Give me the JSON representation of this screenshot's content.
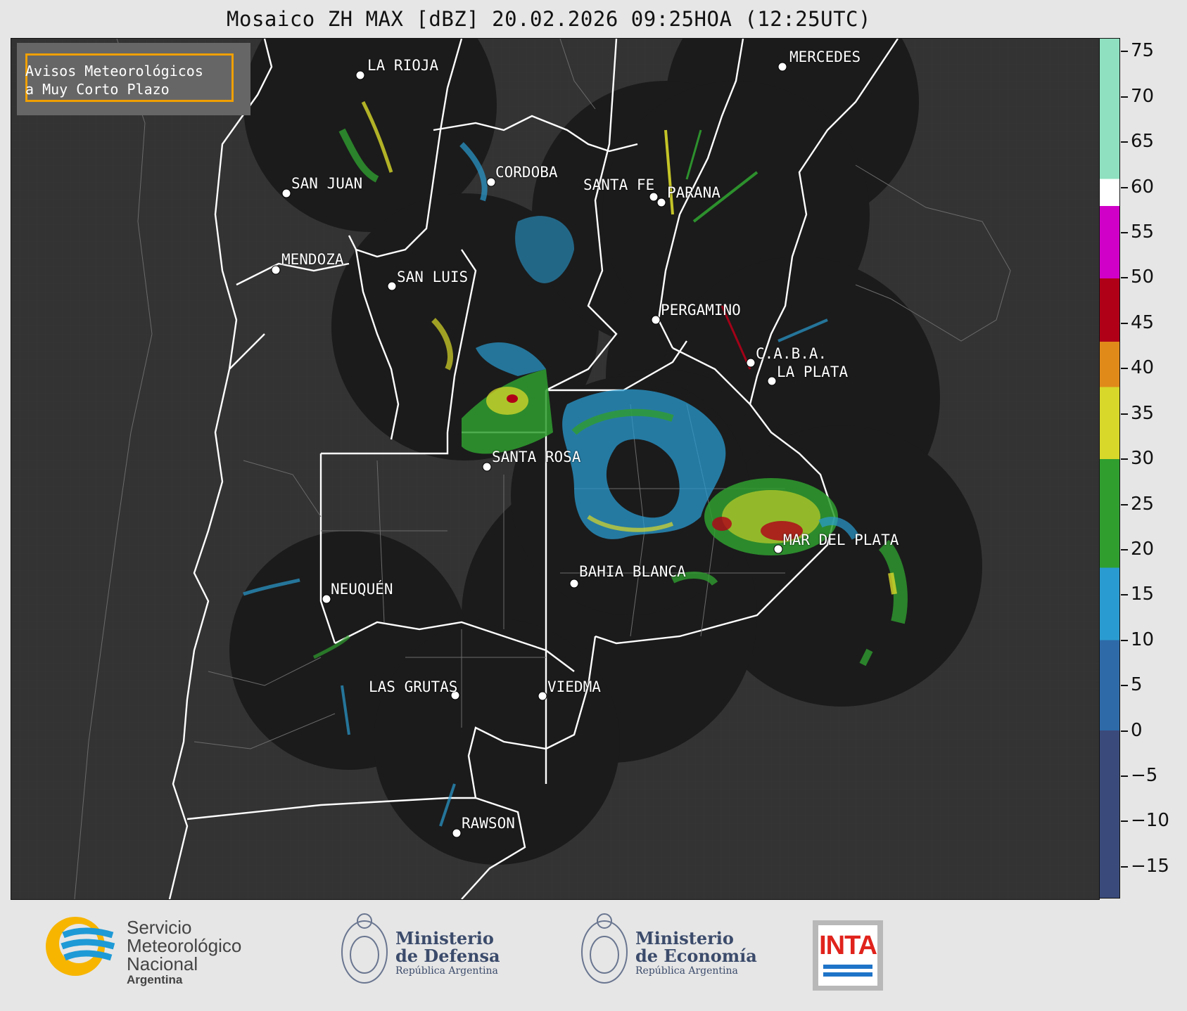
{
  "title": "Mosaico ZH MAX [dBZ] 20.02.2026 09:25HOA (12:25UTC)",
  "notice": {
    "line1": "Avisos Meteorológicos",
    "line2": "a Muy Corto Plazo"
  },
  "cities": [
    {
      "name": "LA RIOJA"
    },
    {
      "name": "MERCEDES"
    },
    {
      "name": "SAN JUAN"
    },
    {
      "name": "CORDOBA"
    },
    {
      "name": "SANTA FE"
    },
    {
      "name": "PARANA"
    },
    {
      "name": "MENDOZA"
    },
    {
      "name": "SAN LUIS"
    },
    {
      "name": "PERGAMINO"
    },
    {
      "name": "C.A.B.A."
    },
    {
      "name": "LA PLATA"
    },
    {
      "name": "SANTA ROSA"
    },
    {
      "name": "MAR DEL PLATA"
    },
    {
      "name": "BAHIA BLANCA"
    },
    {
      "name": "NEUQUÉN"
    },
    {
      "name": "LAS GRUTAS"
    },
    {
      "name": "VIEDMA"
    },
    {
      "name": "RAWSON"
    }
  ],
  "colorbar": {
    "unit": "dBZ",
    "ticks": [
      "75",
      "70",
      "65",
      "60",
      "55",
      "50",
      "45",
      "40",
      "35",
      "30",
      "25",
      "20",
      "15",
      "10",
      "5",
      "0",
      "−5",
      "−10",
      "−15"
    ],
    "range": [
      -18.5,
      76.5
    ],
    "stops": [
      {
        "from": -18.5,
        "to": 0,
        "color": "#3a4a7a"
      },
      {
        "from": 0,
        "to": 10,
        "color": "#2e6aa8"
      },
      {
        "from": 10,
        "to": 18,
        "color": "#2a9bd0"
      },
      {
        "from": 18,
        "to": 30,
        "color": "#2f9e2f"
      },
      {
        "from": 30,
        "to": 38,
        "color": "#d8d82a"
      },
      {
        "from": 38,
        "to": 43,
        "color": "#e08a1a"
      },
      {
        "from": 43,
        "to": 50,
        "color": "#b00018"
      },
      {
        "from": 50,
        "to": 58,
        "color": "#d000c8"
      },
      {
        "from": 58,
        "to": 61,
        "color": "#ffffff"
      },
      {
        "from": 61,
        "to": 76.5,
        "color": "#8ee0c0"
      }
    ]
  },
  "logos": {
    "smn": {
      "line1": "Servicio",
      "line2": "Meteorológico",
      "line3": "Nacional",
      "line4": "Argentina"
    },
    "defensa": {
      "line1": "Ministerio",
      "line2": "de Defensa",
      "line3": "República Argentina"
    },
    "economia": {
      "line1": "Ministerio",
      "line2": "de Economía",
      "line3": "República Argentina"
    },
    "inta": {
      "label": "INTA"
    }
  }
}
